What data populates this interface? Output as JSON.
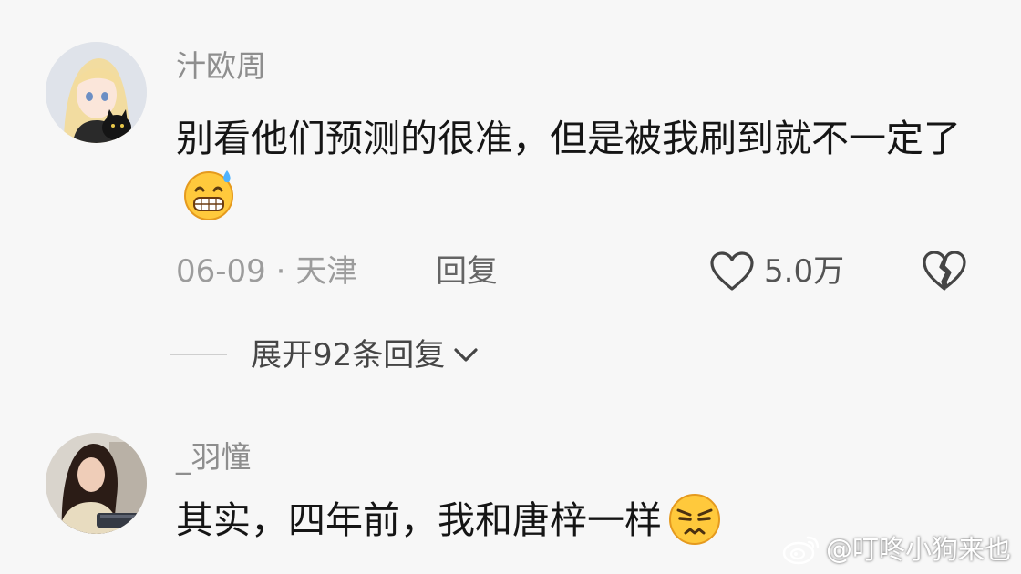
{
  "comments": [
    {
      "username": "汁欧周",
      "text": "别看他们预测的很准，但是被我刷到就不一定了",
      "emoji": "grinning-sweat-emoji",
      "date_location": "06-09 · 天津",
      "reply_label": "回复",
      "like_count": "5.0万",
      "expand_label": "展开92条回复"
    },
    {
      "username": "_羽憧",
      "text": "其实，四年前，我和唐梓一样",
      "emoji": "frowning-annoyed-emoji"
    }
  ],
  "watermark": "@叮咚小狗来也",
  "colors": {
    "background": "#f7f7f7",
    "username": "#8e8e8e",
    "text": "#151515",
    "meta": "#9c9c9c",
    "emoji_yellow": "#ffc93c"
  }
}
